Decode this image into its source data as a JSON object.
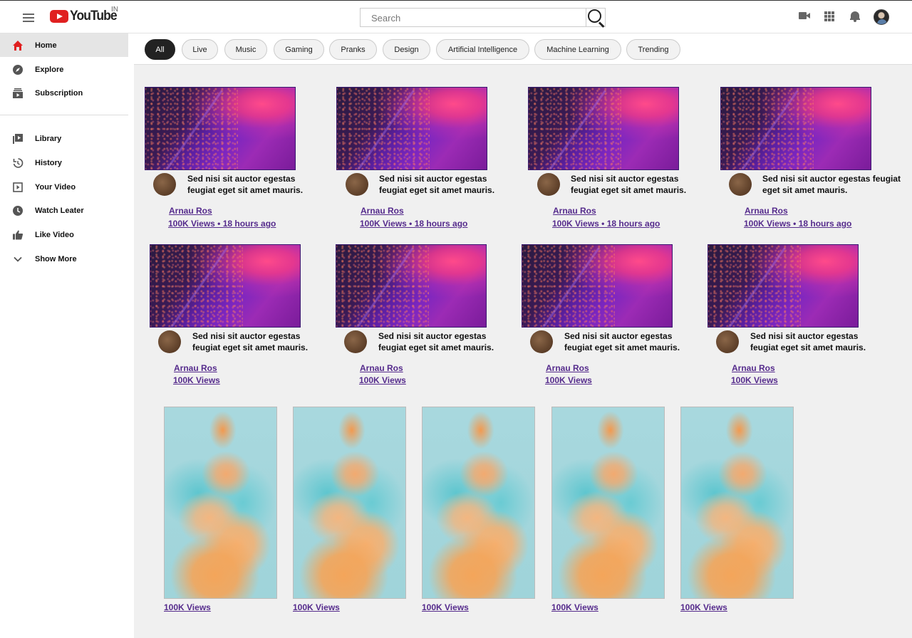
{
  "header": {
    "logo_text": "YouTube",
    "logo_country": "IN",
    "search_placeholder": "Search"
  },
  "sidebar": {
    "items": [
      {
        "label": "Home",
        "icon": "home-icon",
        "active": true
      },
      {
        "label": "Explore",
        "icon": "compass-icon"
      },
      {
        "label": "Subscription",
        "icon": "subscriptions-icon"
      },
      {
        "label": "Library",
        "icon": "library-icon"
      },
      {
        "label": "History",
        "icon": "history-icon"
      },
      {
        "label": "Your Video",
        "icon": "play-square-icon"
      },
      {
        "label": "Watch Leater",
        "icon": "clock-icon"
      },
      {
        "label": "Like Video",
        "icon": "thumbs-up-icon"
      },
      {
        "label": "Show More",
        "icon": "chevron-down-icon"
      }
    ]
  },
  "chips": [
    "All",
    "Live",
    "Music",
    "Gaming",
    "Pranks",
    "Design",
    "Artificial Intelligence",
    "Machine Learning",
    "Trending"
  ],
  "videos_row1": [
    {
      "title": "Sed nisi sit auctor egestas feugiat eget sit amet mauris.",
      "channel": "Arnau Ros",
      "meta": "100K Views • 18 hours ago"
    },
    {
      "title": "Sed nisi sit auctor egestas feugiat eget sit amet mauris.",
      "channel": "Arnau Ros",
      "meta": "100K Views • 18 hours ago"
    },
    {
      "title": "Sed nisi sit auctor egestas feugiat eget sit amet mauris.",
      "channel": "Arnau Ros",
      "meta": "100K Views • 18 hours ago"
    },
    {
      "title": "Sed nisi sit auctor egestas feugiat eget sit amet mauris.",
      "channel": "Arnau Ros",
      "meta": "100K Views • 18 hours ago"
    }
  ],
  "videos_row2": [
    {
      "title": "Sed nisi sit auctor egestas feugiat eget sit amet mauris.",
      "channel": "Arnau Ros",
      "meta": "100K Views"
    },
    {
      "title": "Sed nisi sit auctor egestas feugiat eget sit amet mauris.",
      "channel": "Arnau Ros",
      "meta": "100K Views"
    },
    {
      "title": "Sed nisi sit auctor egestas feugiat eget sit amet mauris.",
      "channel": "Arnau Ros",
      "meta": "100K Views"
    },
    {
      "title": "Sed nisi sit auctor egestas feugiat eget sit amet mauris.",
      "channel": "Arnau Ros",
      "meta": "100K Views"
    }
  ],
  "shorts": [
    {
      "meta": "100K Views"
    },
    {
      "meta": "100K Views"
    },
    {
      "meta": "100K Views"
    },
    {
      "meta": "100K Views"
    },
    {
      "meta": "100K Views"
    }
  ],
  "colors": {
    "accent": "#e02020",
    "link": "#552b8c",
    "chip_active": "#222222"
  }
}
